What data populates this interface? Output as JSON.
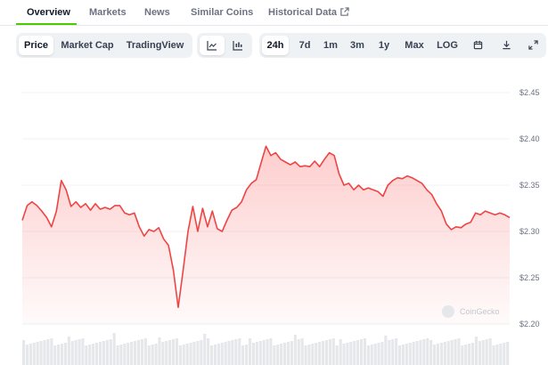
{
  "tabs": [
    {
      "label": "Overview"
    },
    {
      "label": "Markets"
    },
    {
      "label": "News"
    },
    {
      "label": "Similar Coins"
    },
    {
      "label": "Historical Data"
    }
  ],
  "toolbar": {
    "chart_kind": [
      "Price",
      "Market Cap",
      "TradingView"
    ],
    "chart_style_icons": [
      "line-chart-icon",
      "candlestick-chart-icon"
    ],
    "ranges": [
      "24h",
      "7d",
      "1m",
      "3m",
      "1y",
      "Max",
      "LOG"
    ],
    "action_icons": [
      "calendar-icon",
      "download-icon",
      "expand-icon"
    ],
    "selected_kind": "Price",
    "selected_style": "line",
    "selected_range": "24h"
  },
  "watermark": "CoinGecko",
  "colors": {
    "line": "#ef4444",
    "fill": "#fde2e2",
    "tab_accent": "#4bcc00"
  },
  "chart_data": {
    "type": "area",
    "ylim": [
      2.2,
      2.45
    ],
    "y_ticks": [
      "$2.45",
      "$2.40",
      "$2.35",
      "$2.30",
      "$2.25",
      "$2.20"
    ],
    "x": [
      0,
      1,
      2,
      3,
      4,
      5,
      6,
      7,
      8,
      9,
      10,
      11,
      12,
      13,
      14,
      15,
      16,
      17,
      18,
      19,
      20,
      21,
      22,
      23,
      24,
      25,
      26,
      27,
      28,
      29,
      30,
      31,
      32,
      33,
      34,
      35,
      36,
      37,
      38,
      39,
      40,
      41,
      42,
      43,
      44,
      45,
      46,
      47,
      48,
      49,
      50,
      51,
      52,
      53,
      54,
      55,
      56,
      57,
      58,
      59,
      60,
      61,
      62,
      63,
      64,
      65,
      66,
      67,
      68,
      69,
      70,
      71,
      72,
      73,
      74,
      75,
      76,
      77,
      78,
      79,
      80,
      81,
      82,
      83,
      84,
      85,
      86,
      87,
      88,
      89,
      90,
      91,
      92,
      93,
      94,
      95,
      96,
      97,
      98,
      99,
      100
    ],
    "series": [
      {
        "values": [
          2.312,
          2.328,
          2.332,
          2.328,
          2.322,
          2.315,
          2.305,
          2.322,
          2.355,
          2.345,
          2.327,
          2.332,
          2.326,
          2.33,
          2.323,
          2.33,
          2.324,
          2.326,
          2.324,
          2.328,
          2.328,
          2.32,
          2.318,
          2.32,
          2.305,
          2.295,
          2.302,
          2.3,
          2.304,
          2.292,
          2.285,
          2.258,
          2.218,
          2.258,
          2.3,
          2.327,
          2.3,
          2.325,
          2.305,
          2.322,
          2.303,
          2.3,
          2.312,
          2.323,
          2.326,
          2.332,
          2.345,
          2.352,
          2.356,
          2.374,
          2.392,
          2.382,
          2.385,
          2.378,
          2.375,
          2.372,
          2.375,
          2.37,
          2.371,
          2.37,
          2.376,
          2.37,
          2.378,
          2.385,
          2.382,
          2.362,
          2.35,
          2.352,
          2.345,
          2.35,
          2.345,
          2.347,
          2.345,
          2.343,
          2.338,
          2.35,
          2.355,
          2.358,
          2.357,
          2.36,
          2.358,
          2.355,
          2.352,
          2.345,
          2.34,
          2.33,
          2.322,
          2.308,
          2.302,
          2.305,
          2.304,
          2.308,
          2.31,
          2.32,
          2.318,
          2.322,
          2.32,
          2.318,
          2.32,
          2.318,
          2.315
        ]
      }
    ],
    "grid": true,
    "volume_bars": true
  }
}
